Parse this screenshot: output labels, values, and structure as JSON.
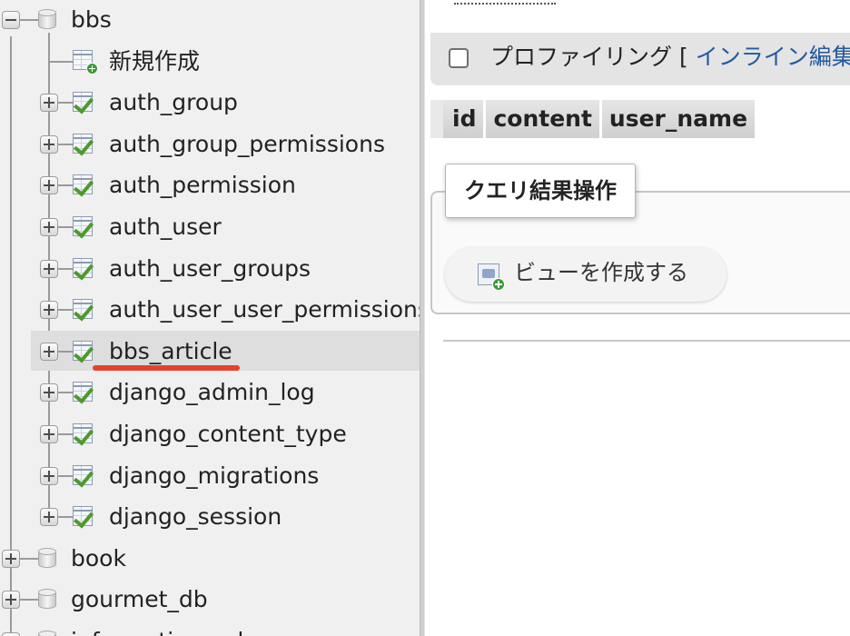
{
  "navigation": {
    "databases": [
      {
        "name": "bbs",
        "expanded": true
      },
      {
        "name": "book",
        "expanded": false
      },
      {
        "name": "gourmet_db",
        "expanded": false
      },
      {
        "name": "information_schema",
        "expanded": false
      }
    ],
    "bbs_children": {
      "new_label": "新規作成",
      "tables": [
        "auth_group",
        "auth_group_permissions",
        "auth_permission",
        "auth_user",
        "auth_user_groups",
        "auth_user_user_permissions",
        "bbs_article",
        "django_admin_log",
        "django_content_type",
        "django_migrations",
        "django_session"
      ],
      "selected_table": "bbs_article"
    }
  },
  "main": {
    "profiling": {
      "label": "プロファイリング",
      "bracket": "[",
      "link": "インライン編集"
    },
    "result_columns": [
      "id",
      "content",
      "user_name"
    ],
    "query_ops": {
      "legend": "クエリ結果操作",
      "create_view_label": "ビューを作成する"
    }
  },
  "colors": {
    "nav_bg": "#f0f0f0",
    "link": "#235a9f",
    "annotation_underline": "#e8412c",
    "table_check": "#4c9a2a"
  }
}
